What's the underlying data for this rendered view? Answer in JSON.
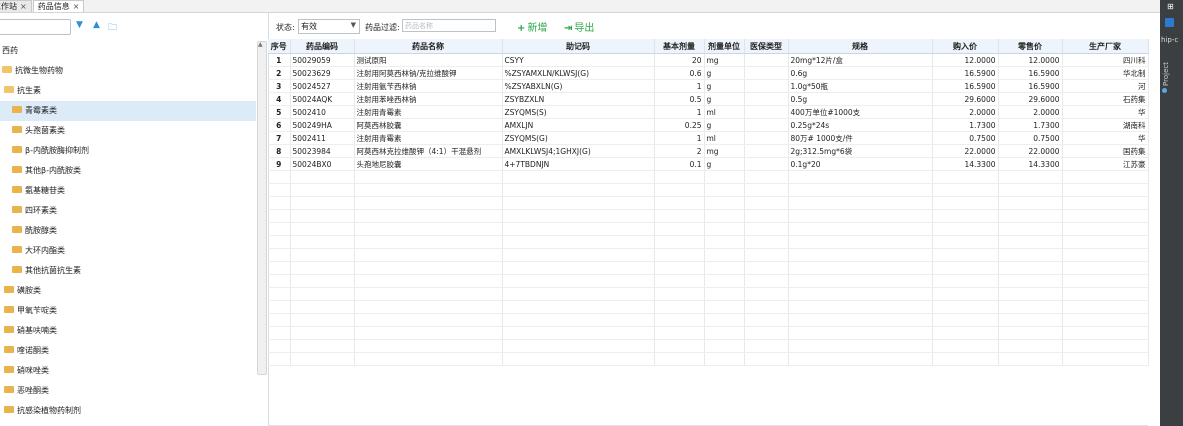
{
  "tabs": [
    {
      "label": "工作站",
      "close": "×",
      "active": false
    },
    {
      "label": "药品信息",
      "close": "×",
      "active": true
    }
  ],
  "left_toolbar": {
    "icons": [
      "filter-down-icon",
      "collapse-up-icon",
      "folder-icon"
    ]
  },
  "tree": [
    {
      "label": "西药",
      "level": 0,
      "folder": false
    },
    {
      "label": "抗微生物药物",
      "level": 0,
      "folder": true
    },
    {
      "label": "抗生素",
      "level": 1,
      "folder": true
    },
    {
      "label": "青霉素类",
      "level": 2,
      "folder": true,
      "selected": true
    },
    {
      "label": "头孢菌素类",
      "level": 2,
      "folder": true
    },
    {
      "label": "β-内酰胺酶抑制剂",
      "level": 2,
      "folder": true
    },
    {
      "label": "其他β-内酰胺类",
      "level": 2,
      "folder": true
    },
    {
      "label": "氨基糖苷类",
      "level": 2,
      "folder": true
    },
    {
      "label": "四环素类",
      "level": 2,
      "folder": true
    },
    {
      "label": "酰胺醇类",
      "level": 2,
      "folder": true
    },
    {
      "label": "大环内酯类",
      "level": 2,
      "folder": true
    },
    {
      "label": "其他抗菌抗生素",
      "level": 2,
      "folder": true
    },
    {
      "label": "磺胺类",
      "level": 1,
      "folder": true
    },
    {
      "label": "甲氧苄啶类",
      "level": 1,
      "folder": true
    },
    {
      "label": "硝基呋喃类",
      "level": 1,
      "folder": true
    },
    {
      "label": "喹诺酮类",
      "level": 1,
      "folder": true
    },
    {
      "label": "硝咪唑类",
      "level": 1,
      "folder": true
    },
    {
      "label": "恶唑酮类",
      "level": 1,
      "folder": true
    },
    {
      "label": "抗感染植物药制剂",
      "level": 1,
      "folder": true
    }
  ],
  "filter": {
    "status_label": "状态:",
    "status_value": "有效",
    "drug_filter_label": "药品过滤:",
    "drug_filter_placeholder": "药品名称",
    "add_label": "新增",
    "export_label": "导出"
  },
  "grid": {
    "columns": [
      "序号",
      "药品编码",
      "药品名称",
      "助记码",
      "基本剂量",
      "剂量单位",
      "医保类型",
      "规格",
      "购入价",
      "零售价",
      "生产厂家"
    ],
    "rows": [
      [
        "1",
        "50029059",
        "测试原阳",
        "CSYY",
        "20",
        "mg",
        "",
        "20mg*12片/盒",
        "12.0000",
        "12.0000",
        "四川科"
      ],
      [
        "2",
        "50023629",
        "注射用阿莫西林钠/克拉维酸钾",
        "%ZSYAMXLN/KLWSJ(G)",
        "0.6",
        "g",
        "",
        "0.6g",
        "16.5900",
        "16.5900",
        "华北制"
      ],
      [
        "3",
        "50024527",
        "注射用氨苄西林钠",
        "%ZSYABXLN(G)",
        "1",
        "g",
        "",
        "1.0g*50瓶",
        "16.5900",
        "16.5900",
        "河"
      ],
      [
        "4",
        "50024AQK",
        "注射用苯唑西林钠",
        "ZSYBZXLN",
        "0.5",
        "g",
        "",
        "0.5g",
        "29.6000",
        "29.6000",
        "石药集"
      ],
      [
        "5",
        "5002410",
        "注射用青霉素",
        "ZSYQMS(S)",
        "1",
        "ml",
        "",
        "400万单位#1000支",
        "2.0000",
        "2.0000",
        "华"
      ],
      [
        "6",
        "500249HA",
        "阿莫西林胶囊",
        "AMXLJN",
        "0.25",
        "g",
        "",
        "0.25g*24s",
        "1.7300",
        "1.7300",
        "湖南科"
      ],
      [
        "7",
        "5002411",
        "注射用青霉素",
        "ZSYQMS(G)",
        "1",
        "ml",
        "",
        "80万# 1000支/件",
        "0.7500",
        "0.7500",
        "华"
      ],
      [
        "8",
        "50023984",
        "阿莫西林克拉维酸钾（4:1）干混悬剂",
        "AMXLKLWSJ4;1GHXJ(G)",
        "2",
        "mg",
        "",
        "2g;312.5mg*6袋",
        "22.0000",
        "22.0000",
        "国药集"
      ],
      [
        "9",
        "50024BX0",
        "头孢地尼胶囊",
        "4+7TBDNJN",
        "0.1",
        "g",
        "",
        "0.1g*20",
        "14.3300",
        "14.3300",
        "江苏豪"
      ]
    ]
  },
  "sidebar": {
    "title": "hip-c",
    "vertical_label": "Project"
  }
}
